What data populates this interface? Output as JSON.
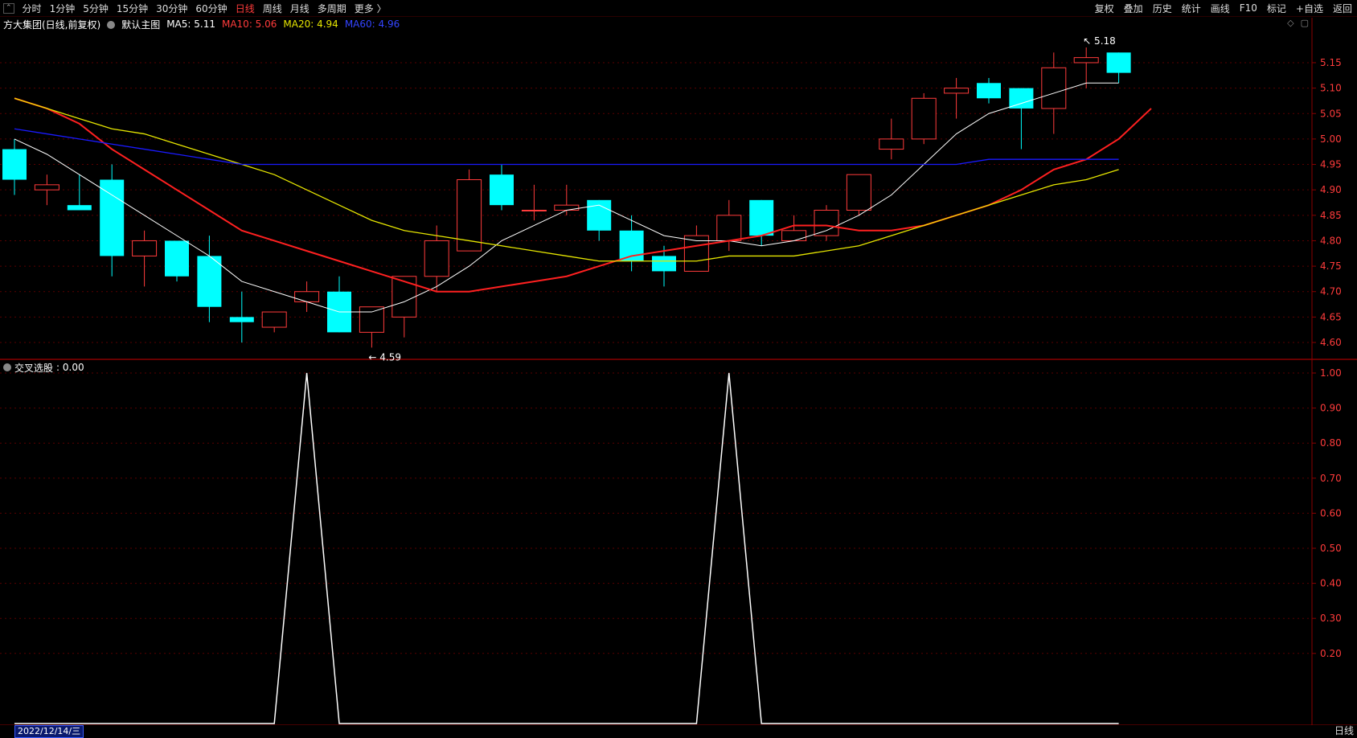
{
  "toolbar": {
    "periods": [
      "分时",
      "1分钟",
      "5分钟",
      "15分钟",
      "30分钟",
      "60分钟",
      "日线",
      "周线",
      "月线",
      "多周期",
      "更多 〉"
    ],
    "active_period": "日线",
    "right_buttons": [
      "复权",
      "叠加",
      "历史",
      "统计",
      "画线",
      "F10",
      "标记",
      "+自选",
      "返回"
    ]
  },
  "legend": {
    "stock": "方大集团(日线,前复权)",
    "template": "默认主图",
    "ma5": "MA5: 5.11",
    "ma10": "MA10: 5.06",
    "ma20": "MA20: 4.94",
    "ma60": "MA60: 4.96"
  },
  "sub_legend": {
    "name": "交叉选股",
    "value": ": 0.00"
  },
  "footer": {
    "date": "2022/12/14/三",
    "period": "日线"
  },
  "colors": {
    "up": "#ff3b3b",
    "down": "#00ffff",
    "ma5": "#ffffff",
    "ma10": "#ff2020",
    "ma20": "#e6e600",
    "ma60": "#1a1aff",
    "axis": "#8b0000"
  },
  "chart_data": [
    {
      "type": "candlestick",
      "title": "方大集团(日线,前复权)",
      "ylim": [
        4.57,
        5.21
      ],
      "y_ticks": [
        4.6,
        4.65,
        4.7,
        4.75,
        4.8,
        4.85,
        4.9,
        4.95,
        5.0,
        5.05,
        5.1,
        5.15
      ],
      "markers": [
        {
          "label": "5.18",
          "index": 33,
          "value": 5.18
        },
        {
          "label": "4.59",
          "index": 11,
          "value": 4.59
        }
      ],
      "candles": [
        {
          "o": 4.98,
          "h": 5.0,
          "l": 4.89,
          "c": 4.92
        },
        {
          "o": 4.9,
          "h": 4.93,
          "l": 4.87,
          "c": 4.91
        },
        {
          "o": 4.87,
          "h": 4.93,
          "l": 4.86,
          "c": 4.86
        },
        {
          "o": 4.92,
          "h": 4.95,
          "l": 4.73,
          "c": 4.77
        },
        {
          "o": 4.77,
          "h": 4.82,
          "l": 4.71,
          "c": 4.8
        },
        {
          "o": 4.8,
          "h": 4.8,
          "l": 4.72,
          "c": 4.73
        },
        {
          "o": 4.77,
          "h": 4.81,
          "l": 4.64,
          "c": 4.67
        },
        {
          "o": 4.65,
          "h": 4.7,
          "l": 4.6,
          "c": 4.64
        },
        {
          "o": 4.63,
          "h": 4.66,
          "l": 4.62,
          "c": 4.66
        },
        {
          "o": 4.68,
          "h": 4.72,
          "l": 4.66,
          "c": 4.7
        },
        {
          "o": 4.7,
          "h": 4.73,
          "l": 4.62,
          "c": 4.62
        },
        {
          "o": 4.62,
          "h": 4.67,
          "l": 4.59,
          "c": 4.67
        },
        {
          "o": 4.65,
          "h": 4.73,
          "l": 4.61,
          "c": 4.73
        },
        {
          "o": 4.73,
          "h": 4.83,
          "l": 4.7,
          "c": 4.8
        },
        {
          "o": 4.78,
          "h": 4.94,
          "l": 4.78,
          "c": 4.92
        },
        {
          "o": 4.93,
          "h": 4.95,
          "l": 4.86,
          "c": 4.87
        },
        {
          "o": 4.86,
          "h": 4.91,
          "l": 4.84,
          "c": 4.86
        },
        {
          "o": 4.86,
          "h": 4.91,
          "l": 4.85,
          "c": 4.87
        },
        {
          "o": 4.88,
          "h": 4.88,
          "l": 4.8,
          "c": 4.82
        },
        {
          "o": 4.82,
          "h": 4.85,
          "l": 4.74,
          "c": 4.76
        },
        {
          "o": 4.77,
          "h": 4.79,
          "l": 4.71,
          "c": 4.74
        },
        {
          "o": 4.74,
          "h": 4.83,
          "l": 4.74,
          "c": 4.81
        },
        {
          "o": 4.8,
          "h": 4.88,
          "l": 4.78,
          "c": 4.85
        },
        {
          "o": 4.88,
          "h": 4.88,
          "l": 4.79,
          "c": 4.81
        },
        {
          "o": 4.8,
          "h": 4.85,
          "l": 4.8,
          "c": 4.82
        },
        {
          "o": 4.81,
          "h": 4.87,
          "l": 4.8,
          "c": 4.86
        },
        {
          "o": 4.86,
          "h": 4.93,
          "l": 4.85,
          "c": 4.93
        },
        {
          "o": 4.98,
          "h": 5.04,
          "l": 4.96,
          "c": 5.0
        },
        {
          "o": 5.0,
          "h": 5.09,
          "l": 4.99,
          "c": 5.08
        },
        {
          "o": 5.09,
          "h": 5.12,
          "l": 5.04,
          "c": 5.1
        },
        {
          "o": 5.11,
          "h": 5.12,
          "l": 5.07,
          "c": 5.08
        },
        {
          "o": 5.1,
          "h": 5.1,
          "l": 4.98,
          "c": 5.06
        },
        {
          "o": 5.06,
          "h": 5.17,
          "l": 5.01,
          "c": 5.14
        },
        {
          "o": 5.15,
          "h": 5.18,
          "l": 5.1,
          "c": 5.16
        },
        {
          "o": 5.17,
          "h": 5.17,
          "l": 5.11,
          "c": 5.13
        }
      ],
      "series": [
        {
          "name": "MA5",
          "values": [
            5.0,
            4.97,
            4.93,
            4.89,
            4.85,
            4.81,
            4.77,
            4.72,
            4.7,
            4.68,
            4.66,
            4.66,
            4.68,
            4.71,
            4.75,
            4.8,
            4.83,
            4.86,
            4.87,
            4.84,
            4.81,
            4.8,
            4.8,
            4.79,
            4.8,
            4.82,
            4.85,
            4.89,
            4.95,
            5.01,
            5.05,
            5.07,
            5.09,
            5.11,
            5.11
          ]
        },
        {
          "name": "MA10",
          "values": [
            5.08,
            5.06,
            5.03,
            4.98,
            4.94,
            4.9,
            4.86,
            4.82,
            4.8,
            4.78,
            4.76,
            4.74,
            4.72,
            4.7,
            4.7,
            4.71,
            4.72,
            4.73,
            4.75,
            4.77,
            4.78,
            4.79,
            4.8,
            4.81,
            4.83,
            4.83,
            4.82,
            4.82,
            4.83,
            4.85,
            4.87,
            4.9,
            4.94,
            4.96,
            5.0,
            5.06
          ]
        },
        {
          "name": "MA20",
          "values": [
            5.08,
            5.06,
            5.04,
            5.02,
            5.01,
            4.99,
            4.97,
            4.95,
            4.93,
            4.9,
            4.87,
            4.84,
            4.82,
            4.81,
            4.8,
            4.79,
            4.78,
            4.77,
            4.76,
            4.76,
            4.76,
            4.76,
            4.77,
            4.77,
            4.77,
            4.78,
            4.79,
            4.81,
            4.83,
            4.85,
            4.87,
            4.89,
            4.91,
            4.92,
            4.94
          ]
        },
        {
          "name": "MA60",
          "values": [
            5.02,
            5.01,
            5.0,
            4.99,
            4.98,
            4.97,
            4.96,
            4.95,
            4.95,
            4.95,
            4.95,
            4.95,
            4.95,
            4.95,
            4.95,
            4.95,
            4.95,
            4.95,
            4.95,
            4.95,
            4.95,
            4.95,
            4.95,
            4.95,
            4.95,
            4.95,
            4.95,
            4.95,
            4.95,
            4.95,
            4.96,
            4.96,
            4.96,
            4.96,
            4.96
          ]
        }
      ]
    },
    {
      "type": "line",
      "title": "交叉选股",
      "ylim": [
        0.0,
        1.0
      ],
      "y_ticks": [
        0.2,
        0.3,
        0.4,
        0.5,
        0.6,
        0.7,
        0.8,
        0.9,
        1.0
      ],
      "series": [
        {
          "name": "交叉选股",
          "values": [
            0,
            0,
            0,
            0,
            0,
            0,
            0,
            0,
            0,
            1,
            0,
            0,
            0,
            0,
            0,
            0,
            0,
            0,
            0,
            0,
            0,
            0,
            1,
            0,
            0,
            0,
            0,
            0,
            0,
            0,
            0,
            0,
            0,
            0,
            0
          ]
        }
      ]
    }
  ]
}
